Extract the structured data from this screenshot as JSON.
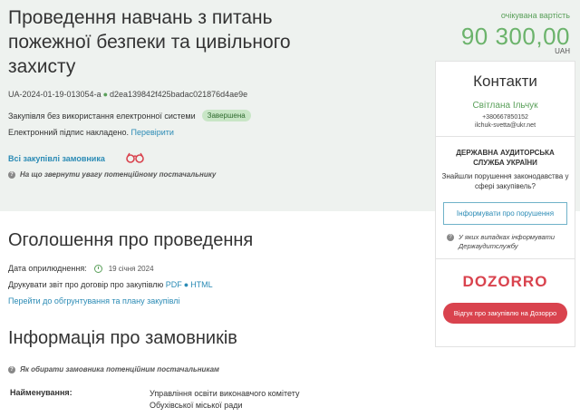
{
  "tender": {
    "title": "Проведення навчань з питань пожежної безпеки та цивільного захисту",
    "id": "UA-2024-01-19-013054-a",
    "hash": "d2ea139842f425badac021876d4ae9e",
    "procedure": "Закупівля без використання електронної системи",
    "status": "Завершена",
    "signature_text": "Електронний підпис накладено.",
    "signature_link": "Перевірити",
    "all_purchases": "Всі закупівлі замовника",
    "attention": "На що звернути увагу потенційному постачальнику"
  },
  "value": {
    "label": "очікувана вартість",
    "amount": "90 300,00",
    "currency": "UAH"
  },
  "announcement": {
    "heading": "Оголошення про проведення",
    "pub_label": "Дата оприлюднення:",
    "pub_date": "19 січня 2024",
    "print_text": "Друкувати звіт про договір про закупівлю",
    "pdf": "PDF",
    "html": "HTML",
    "justification_link": "Перейти до обгрунтування та плану закупівлі"
  },
  "buyer": {
    "heading": "Інформація про замовників",
    "hint": "Як обирати замовника потенційним постачальникам",
    "name_label": "Найменування:",
    "name_value": "Управління освіти виконавчого комітету Обухівської міської ради"
  },
  "sidebar": {
    "contacts_title": "Контакти",
    "contact_name": "Світлана Ільчук",
    "phone": "+380667850152",
    "email": "ilchuk-svetta@ukr.net",
    "audit_title": "ДЕРЖАВНА АУДИТОРСЬКА СЛУЖБА УКРАЇНИ",
    "audit_question": "Знайшли порушення законодавства у сфері закупівель?",
    "inform_button": "Інформувати про порушення",
    "audit_note": "У яких випадках інформувати Держаудитслужбу",
    "dozorro_logo": "DOZORRO",
    "feedback_button": "Відгук про закупівлю на Дозорро"
  },
  "colors": {
    "accent_green": "#6bb36b",
    "link_blue": "#2b8bb5",
    "dozorro_red": "#d9434e",
    "band_bg": "#eef2ef"
  }
}
